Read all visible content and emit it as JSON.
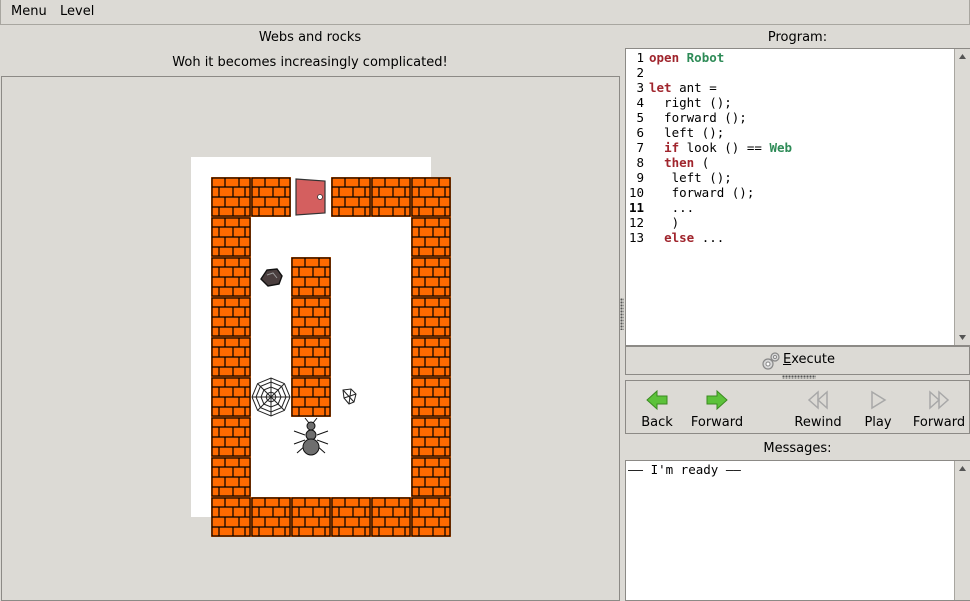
{
  "menubar": {
    "menu": "Menu",
    "level": "Level"
  },
  "level": {
    "title": "Webs and rocks",
    "subtitle": "Woh it becomes increasingly complicated!"
  },
  "board": {
    "cols": 6,
    "rows": 9,
    "grid": [
      "WWDWWW",
      "W....W",
      "WRW..W",
      "W.W..W",
      "W.W..W",
      "WSWs.W",
      "W.A..W",
      "W....W",
      "WWWWWW"
    ],
    "legend": {
      "W": "brick-wall",
      "D": "exit-door",
      "R": "rock",
      "S": "spider-web",
      "s": "small-web",
      "A": "ant"
    },
    "colors": {
      "brick": "#ff6a00",
      "door": "#d45f5f",
      "ant": "#6e6e6e"
    }
  },
  "program": {
    "label": "Program:",
    "current_line": 11,
    "lines": [
      [
        {
          "t": "open",
          "c": "kw"
        },
        {
          "t": " "
        },
        {
          "t": "Robot",
          "c": "cn"
        }
      ],
      [],
      [
        {
          "t": "let",
          "c": "kw"
        },
        {
          "t": " ant ="
        }
      ],
      [
        {
          "t": "  right ();"
        }
      ],
      [
        {
          "t": "  forward ();"
        }
      ],
      [
        {
          "t": "  left ();"
        }
      ],
      [
        {
          "t": "  "
        },
        {
          "t": "if",
          "c": "kw"
        },
        {
          "t": " look () == "
        },
        {
          "t": "Web",
          "c": "cn"
        }
      ],
      [
        {
          "t": "  "
        },
        {
          "t": "then",
          "c": "kw"
        },
        {
          "t": " ("
        }
      ],
      [
        {
          "t": "   left ();"
        }
      ],
      [
        {
          "t": "   forward ();"
        }
      ],
      [
        {
          "t": "   ..."
        }
      ],
      [
        {
          "t": "   )"
        }
      ],
      [
        {
          "t": "  "
        },
        {
          "t": "else",
          "c": "kw"
        },
        {
          "t": " ..."
        }
      ]
    ]
  },
  "execute": {
    "label": "Execute",
    "mnemonic": "E",
    "rest": "xecute",
    "icon": "gears-icon"
  },
  "toolbar": {
    "back": "Back",
    "forward": "Forward",
    "rewind": "Rewind",
    "play": "Play",
    "fast_forward": "Forward",
    "colors": {
      "active": "#4caf2a",
      "inactive": "#a8a8a8"
    }
  },
  "messages": {
    "label": "Messages:",
    "text": "—— I'm ready ——"
  }
}
